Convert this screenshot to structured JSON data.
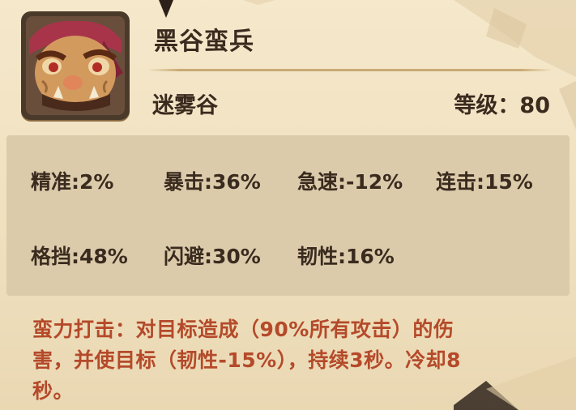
{
  "unit": {
    "name": "黑谷蛮兵",
    "region": "迷雾谷",
    "level_text": "等级：80"
  },
  "portrait": {
    "icon": "barbarian-portrait-icon"
  },
  "stats": [
    {
      "key": "accuracy",
      "text": "精准:2%"
    },
    {
      "key": "crit",
      "text": "暴击:36%"
    },
    {
      "key": "haste",
      "text": "急速:-12%"
    },
    {
      "key": "combo",
      "text": "连击:15%"
    },
    {
      "key": "block",
      "text": "格挡:48%"
    },
    {
      "key": "dodge",
      "text": "闪避:30%"
    },
    {
      "key": "toughness",
      "text": "韧性:16%"
    }
  ],
  "skill": {
    "lines": [
      "蛮力打击：对目标造成（90%所有攻击）的伤",
      "害，并使目标（韧性-15%），持续3秒。冷却8",
      "秒。"
    ]
  },
  "colors": {
    "paper": "#f1e2c2",
    "stats_box": "#dccbab",
    "text_dark": "#3b2a1e",
    "skill_text": "#b44a2a"
  }
}
